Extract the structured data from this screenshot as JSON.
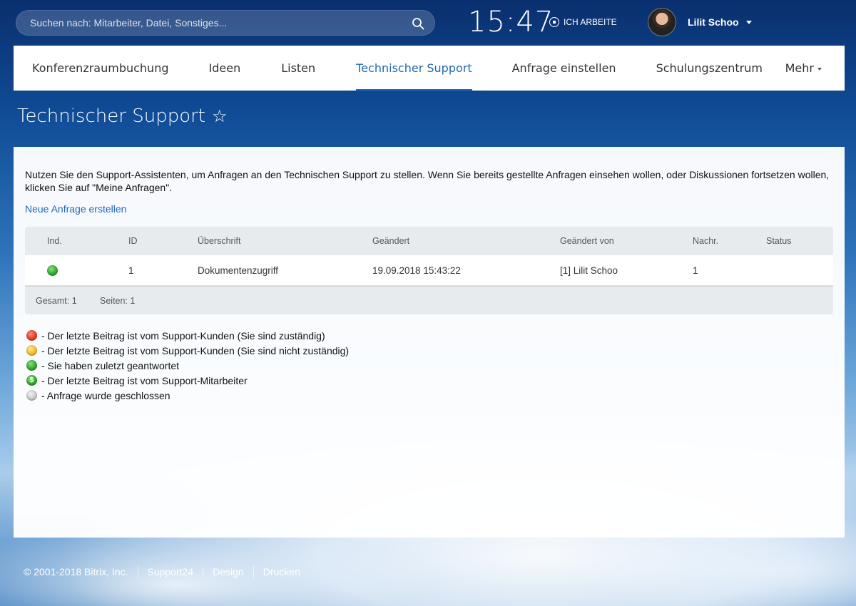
{
  "header": {
    "search_placeholder": "Suchen nach: Mitarbeiter, Datei, Sonstiges...",
    "clock": "15:47",
    "work_status": "ICH ARBEITE",
    "user_name": "Lilit Schoo"
  },
  "nav": {
    "tabs": [
      {
        "label": "Konferenzraumbuchung"
      },
      {
        "label": "Ideen"
      },
      {
        "label": "Listen"
      },
      {
        "label": "Technischer Support"
      },
      {
        "label": "Anfrage einstellen"
      },
      {
        "label": "Schulungszentrum"
      }
    ],
    "active_index": 3,
    "more_label": "Mehr"
  },
  "page": {
    "title": "Technischer Support"
  },
  "main": {
    "intro": "Nutzen Sie den Support-Assistenten, um Anfragen an den Technischen Support zu stellen. Wenn Sie bereits gestellte Anfragen einsehen wollen, oder Diskussionen fortsetzen wollen, klicken Sie auf \"Meine Anfragen\".",
    "new_request_link": "Neue Anfrage erstellen",
    "table": {
      "columns": [
        "Ind.",
        "ID",
        "Überschrift",
        "Geändert",
        "Geändert von",
        "Nachr.",
        "Status"
      ],
      "rows": [
        {
          "indicator": "green",
          "id": "1",
          "title": "Dokumentenzugriff",
          "modified": "19.09.2018 15:43:22",
          "modified_by": "[1] Lilit Schoo",
          "messages": "1",
          "status": ""
        }
      ],
      "footer_total": "Gesamt: 1",
      "footer_pages": "Seiten: 1"
    },
    "legend": [
      {
        "color": "red",
        "text": "- Der letzte Beitrag ist vom Support-Kunden (Sie sind zuständig)"
      },
      {
        "color": "yellow",
        "text": "- Der letzte Beitrag ist vom Support-Kunden (Sie sind nicht zuständig)"
      },
      {
        "color": "green",
        "text": "- Sie haben zuletzt geantwortet"
      },
      {
        "color": "dollar",
        "symbol": "$",
        "text": "- Der letzte Beitrag ist vom Support-Mitarbeiter"
      },
      {
        "color": "grey",
        "text": "- Anfrage wurde geschlossen"
      }
    ]
  },
  "footer": {
    "copyright": "© 2001-2018 Bitrix, Inc.",
    "links": [
      "Support24",
      "Design",
      "Drucken"
    ]
  },
  "colors": {
    "accent": "#2167b9",
    "status_red": "#e83b26",
    "status_yellow": "#f2b830",
    "status_green": "#2fa82c",
    "status_grey": "#c7c7c7"
  }
}
